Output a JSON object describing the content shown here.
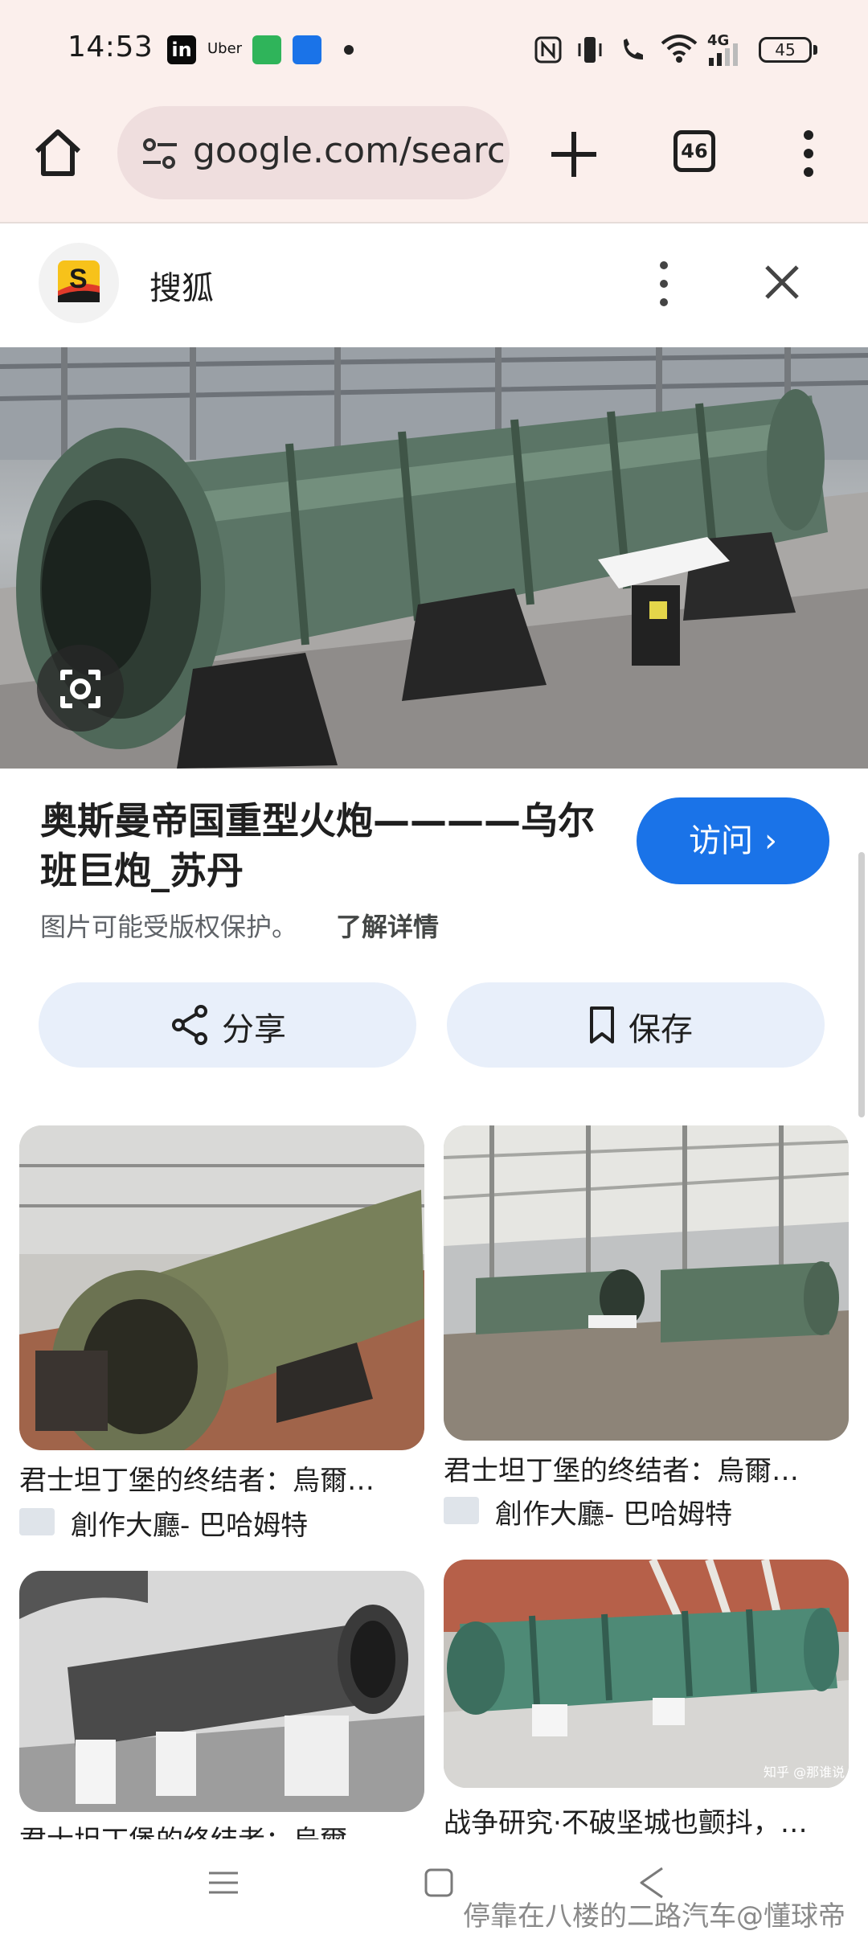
{
  "status_bar": {
    "time": "14:53",
    "uber_label": "Uber",
    "network": "4G",
    "battery": "45"
  },
  "toolbar": {
    "url": "google.com/search"
  },
  "tab_count": "46",
  "source": {
    "name": "搜狐"
  },
  "result": {
    "title": "奥斯曼帝国重型火炮————乌尔班巨炮_苏丹",
    "visit_label": "访问",
    "copyright_text": "图片可能受版权保护。",
    "learn_more": "了解详情",
    "share_label": "分享",
    "save_label": "保存"
  },
  "related": [
    {
      "title": "君士坦丁堡的终结者：烏爾…",
      "source": "創作大廳- 巴哈姆特"
    },
    {
      "title": "君士坦丁堡的终结者：烏爾…",
      "source": "創作大廳- 巴哈姆特"
    },
    {
      "title": "君士坦丁堡的终结者：烏爾…",
      "source": ""
    },
    {
      "title": "战争研究·不破坚城也颤抖，…",
      "source": ""
    }
  ],
  "watermark": "停靠在八楼的二路汽车@懂球帝",
  "image_watermark": "知乎 @那谁说",
  "colors": {
    "accent": "#1a73e8",
    "chrome_bg": "#fbefec",
    "pill_bg": "#e8effa"
  }
}
